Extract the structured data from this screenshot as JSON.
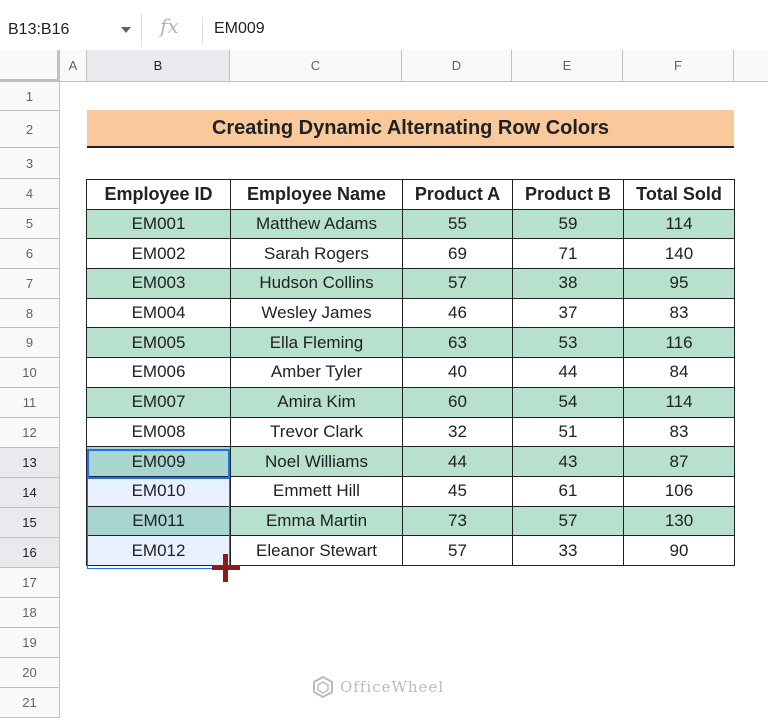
{
  "formula_bar": {
    "name_box": "B13:B16",
    "fx_label": "fx",
    "formula": "EM009"
  },
  "columns": [
    "A",
    "B",
    "C",
    "D",
    "E",
    "F"
  ],
  "rows": [
    "1",
    "2",
    "3",
    "4",
    "5",
    "6",
    "7",
    "8",
    "9",
    "10",
    "11",
    "12",
    "13",
    "14",
    "15",
    "16",
    "17",
    "18",
    "19",
    "20",
    "21"
  ],
  "title": "Creating Dynamic Alternating Row Colors",
  "table": {
    "headers": [
      "Employee ID",
      "Employee Name",
      "Product A",
      "Product B",
      "Total Sold"
    ],
    "rows": [
      [
        "EM001",
        "Matthew Adams",
        "55",
        "59",
        "114"
      ],
      [
        "EM002",
        "Sarah Rogers",
        "69",
        "71",
        "140"
      ],
      [
        "EM003",
        "Hudson Collins",
        "57",
        "38",
        "95"
      ],
      [
        "EM004",
        "Wesley James",
        "46",
        "37",
        "83"
      ],
      [
        "EM005",
        "Ella Fleming",
        "63",
        "53",
        "116"
      ],
      [
        "EM006",
        "Amber Tyler",
        "40",
        "44",
        "84"
      ],
      [
        "EM007",
        "Amira Kim",
        "60",
        "54",
        "114"
      ],
      [
        "EM008",
        "Trevor Clark",
        "32",
        "51",
        "83"
      ],
      [
        "EM009",
        "Noel Williams",
        "44",
        "43",
        "87"
      ],
      [
        "EM010",
        "Emmett Hill",
        "45",
        "61",
        "106"
      ],
      [
        "EM011",
        "Emma Martin",
        "73",
        "57",
        "130"
      ],
      [
        "EM012",
        "Eleanor Stewart",
        "57",
        "33",
        "90"
      ]
    ]
  },
  "colors": {
    "title_fill": "#f9c99b",
    "alternate_row": "#b7e1cd",
    "selection": "#1a73e8"
  },
  "watermark": "OfficeWheel"
}
